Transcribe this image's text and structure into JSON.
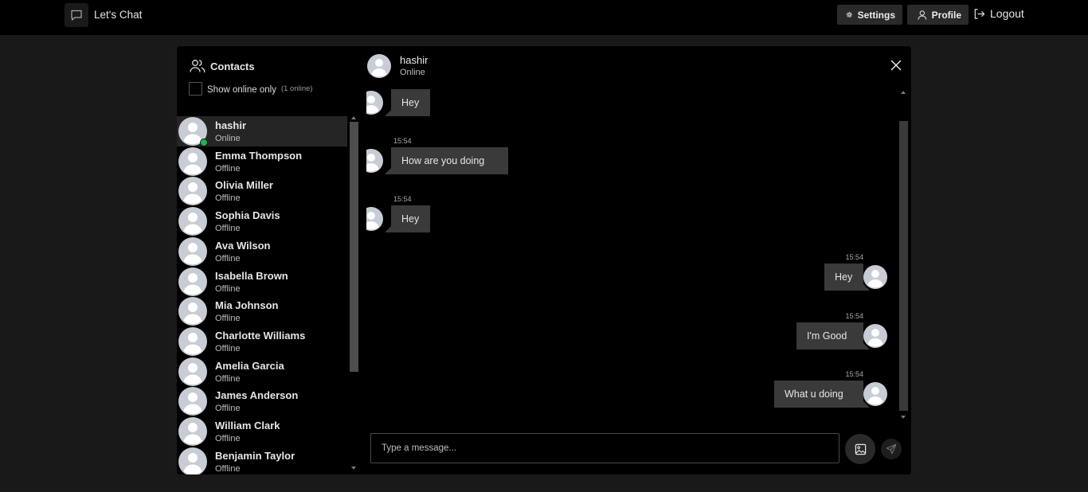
{
  "header": {
    "app_title": "Let's Chat",
    "app_icon": "chat-bubble-icon",
    "settings_label": "Settings",
    "profile_label": "Profile",
    "logout_label": "Logout"
  },
  "contacts": {
    "title": "Contacts",
    "show_online_label": "Show online only",
    "online_count": "(1 online)",
    "items": [
      {
        "name": "hashir",
        "status": "Online"
      },
      {
        "name": "Emma Thompson",
        "status": "Offline"
      },
      {
        "name": "Olivia Miller",
        "status": "Offline"
      },
      {
        "name": "Sophia Davis",
        "status": "Offline"
      },
      {
        "name": "Ava Wilson",
        "status": "Offline"
      },
      {
        "name": "Isabella Brown",
        "status": "Offline"
      },
      {
        "name": "Mia Johnson",
        "status": "Offline"
      },
      {
        "name": "Charlotte Williams",
        "status": "Offline"
      },
      {
        "name": "Amelia Garcia",
        "status": "Offline"
      },
      {
        "name": "James Anderson",
        "status": "Offline"
      },
      {
        "name": "William Clark",
        "status": "Offline"
      },
      {
        "name": "Benjamin Taylor",
        "status": "Offline"
      }
    ]
  },
  "chat": {
    "name": "hashir",
    "status": "Online",
    "messages": [
      {
        "side": "received",
        "time": "",
        "text": "Hey"
      },
      {
        "side": "received",
        "time": "15:54",
        "text": "How are you doing"
      },
      {
        "side": "received",
        "time": "15:54",
        "text": "Hey"
      },
      {
        "side": "sent",
        "time": "15:54",
        "text": "Hey"
      },
      {
        "side": "sent",
        "time": "15:54",
        "text": "I'm Good"
      },
      {
        "side": "sent",
        "time": "15:54",
        "text": "What u doing"
      }
    ],
    "input_placeholder": "Type a message..."
  },
  "colors": {
    "background": "#191919",
    "panel": "#000000",
    "bubble": "#3a3a3a",
    "online": "#22b14c"
  }
}
